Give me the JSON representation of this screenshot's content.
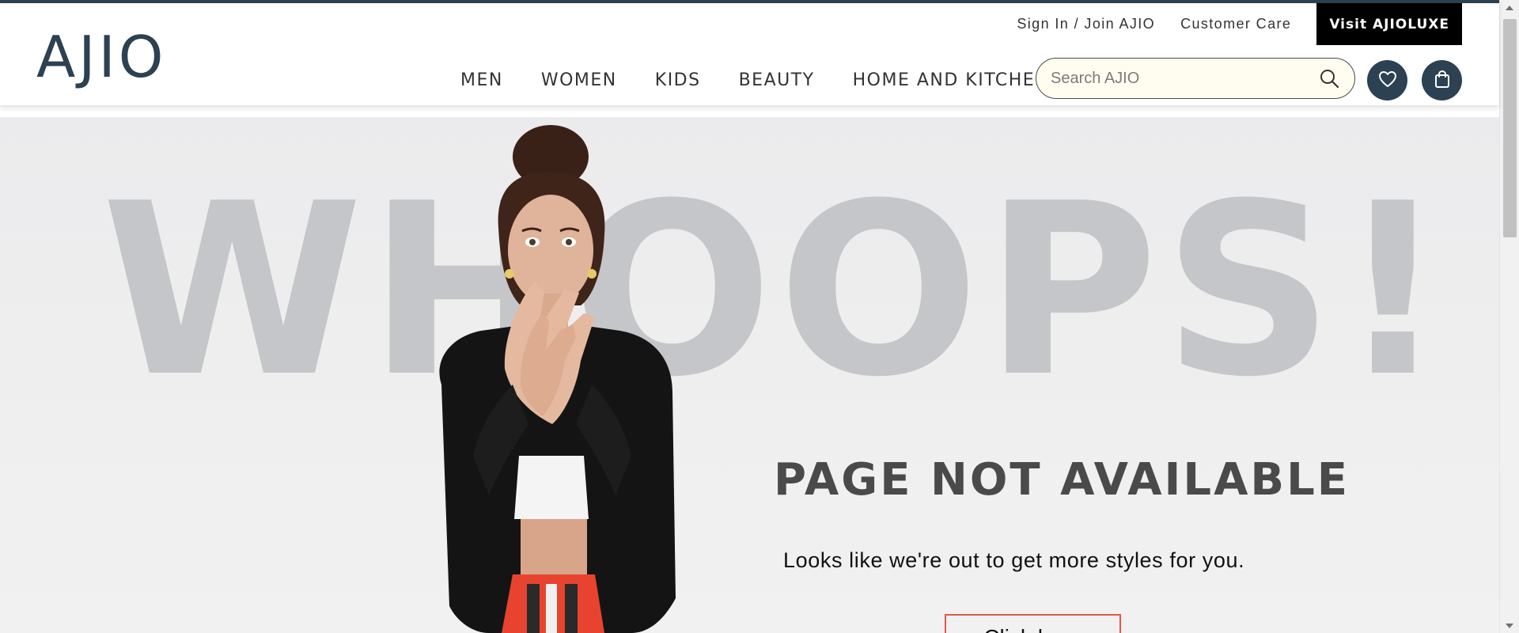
{
  "header": {
    "logo": "AJIO",
    "top_links": {
      "sign_in": "Sign In / Join AJIO",
      "customer_care": "Customer Care",
      "luxe": "Visit AJIOLUXE"
    },
    "nav": [
      {
        "label": "MEN"
      },
      {
        "label": "WOMEN"
      },
      {
        "label": "KIDS"
      },
      {
        "label": "BEAUTY"
      },
      {
        "label": "HOME AND KITCHEN"
      }
    ],
    "search": {
      "placeholder": "Search AJIO",
      "value": ""
    },
    "icons": {
      "search": "search-icon",
      "wishlist": "heart-icon",
      "cart": "bag-icon"
    }
  },
  "hero": {
    "headline": "WHOOPS!",
    "title": "PAGE NOT AVAILABLE",
    "subtitle": "Looks like we're out to get more styles for you.",
    "button": "Click here"
  },
  "colors": {
    "brand": "#2c4152",
    "whoops_text": "#c5c6c9",
    "button_border": "#e0584a"
  }
}
